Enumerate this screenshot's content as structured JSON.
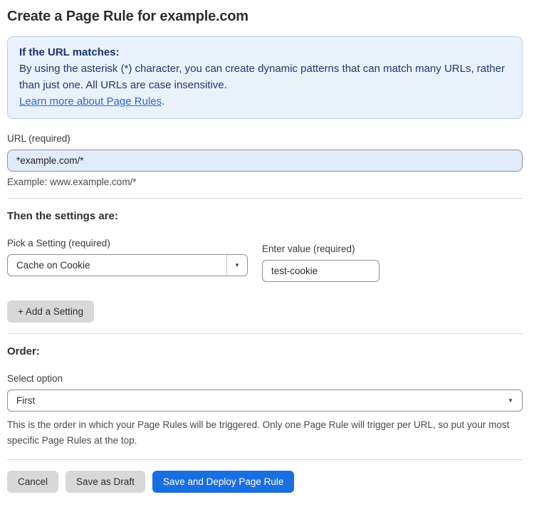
{
  "page": {
    "title": "Create a Page Rule for example.com"
  },
  "info_box": {
    "heading": "If the URL matches:",
    "body": "By using the asterisk (*) character, you can create dynamic patterns that can match many URLs, rather than just one. All URLs are case insensitive.",
    "link_label": "Learn more about Page Rules",
    "link_suffix": "."
  },
  "url_field": {
    "label": "URL (required)",
    "value": "*example.com/*",
    "hint": "Example: www.example.com/*"
  },
  "settings": {
    "heading": "Then the settings are:",
    "setting_label": "Pick a Setting (required)",
    "setting_value": "Cache on Cookie",
    "value_label": "Enter value (required)",
    "value_value": "test-cookie",
    "add_button_label": "+ Add a Setting"
  },
  "order": {
    "heading": "Order:",
    "select_label": "Select option",
    "select_value": "First",
    "description": "This is the order in which your Page Rules will be triggered. Only one Page Rule will trigger per URL, so put your most specific Page Rules at the top."
  },
  "footer": {
    "cancel_label": "Cancel",
    "save_draft_label": "Save as Draft",
    "save_deploy_label": "Save and Deploy Page Rule"
  },
  "icons": {
    "dropdown_arrow": "▼"
  },
  "colors": {
    "accent_blue": "#1a6fe0",
    "info_bg": "#e9f1fb",
    "info_border": "#b7d1ec",
    "info_text": "#1e3a6e",
    "link_blue": "#2b6cc8",
    "url_input_bg": "#e1ecfb",
    "gray_button": "#d8d8d8"
  }
}
